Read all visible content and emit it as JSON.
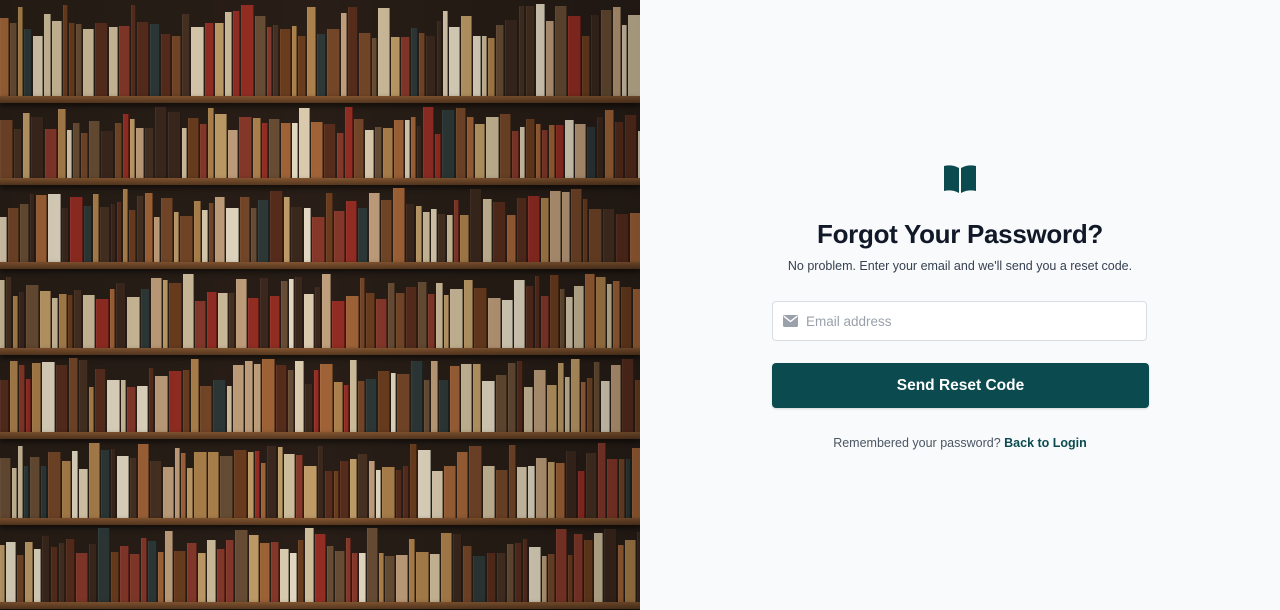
{
  "hero": {
    "image_alt": "bookshelf-photo"
  },
  "brand": {
    "icon": "open-book-icon",
    "accent_color": "#0b4a4f"
  },
  "form": {
    "title": "Forgot Your Password?",
    "subtitle": "No problem. Enter your email and we'll send you a reset code.",
    "email": {
      "icon": "envelope-icon",
      "placeholder": "Email address",
      "value": ""
    },
    "submit_label": "Send Reset Code"
  },
  "footer": {
    "prompt": "Remembered your password?",
    "link_label": "Back to Login"
  }
}
